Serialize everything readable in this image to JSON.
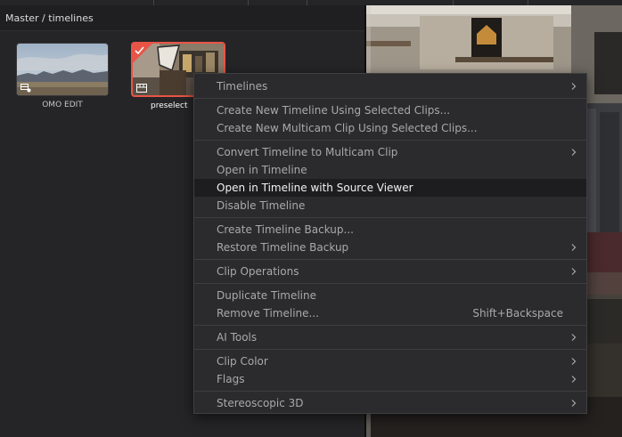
{
  "breadcrumb": "Master / timelines",
  "clips": [
    {
      "name": "OMO EDIT"
    },
    {
      "name": "preselect"
    }
  ],
  "menu": {
    "items": [
      {
        "label": "Timelines",
        "shortcut": "",
        "submenu": true
      },
      {
        "label": "Create New Timeline Using Selected Clips...",
        "shortcut": "",
        "submenu": false
      },
      {
        "label": "Create New Multicam Clip Using Selected Clips...",
        "shortcut": "",
        "submenu": false
      },
      {
        "label": "Convert Timeline to Multicam Clip",
        "shortcut": "",
        "submenu": true
      },
      {
        "label": "Open in Timeline",
        "shortcut": "",
        "submenu": false
      },
      {
        "label": "Open in Timeline with Source Viewer",
        "shortcut": "",
        "submenu": false,
        "highlighted": true
      },
      {
        "label": "Disable Timeline",
        "shortcut": "",
        "submenu": false
      },
      {
        "label": "Create Timeline Backup...",
        "shortcut": "",
        "submenu": false
      },
      {
        "label": "Restore Timeline Backup",
        "shortcut": "",
        "submenu": true
      },
      {
        "label": "Clip Operations",
        "shortcut": "",
        "submenu": true
      },
      {
        "label": "Duplicate Timeline",
        "shortcut": "",
        "submenu": false
      },
      {
        "label": "Remove Timeline...",
        "shortcut": "Shift+Backspace",
        "submenu": false
      },
      {
        "label": "AI Tools",
        "shortcut": "",
        "submenu": true
      },
      {
        "label": "Clip Color",
        "shortcut": "",
        "submenu": true
      },
      {
        "label": "Flags",
        "shortcut": "",
        "submenu": true
      },
      {
        "label": "Stereoscopic 3D",
        "shortcut": "",
        "submenu": true
      }
    ]
  },
  "colors": {
    "selection_border": "#e85546",
    "menu_bg": "#2b2b2d",
    "menu_text": "#a9a9ab",
    "menu_highlight_text": "#f2f2f2"
  }
}
